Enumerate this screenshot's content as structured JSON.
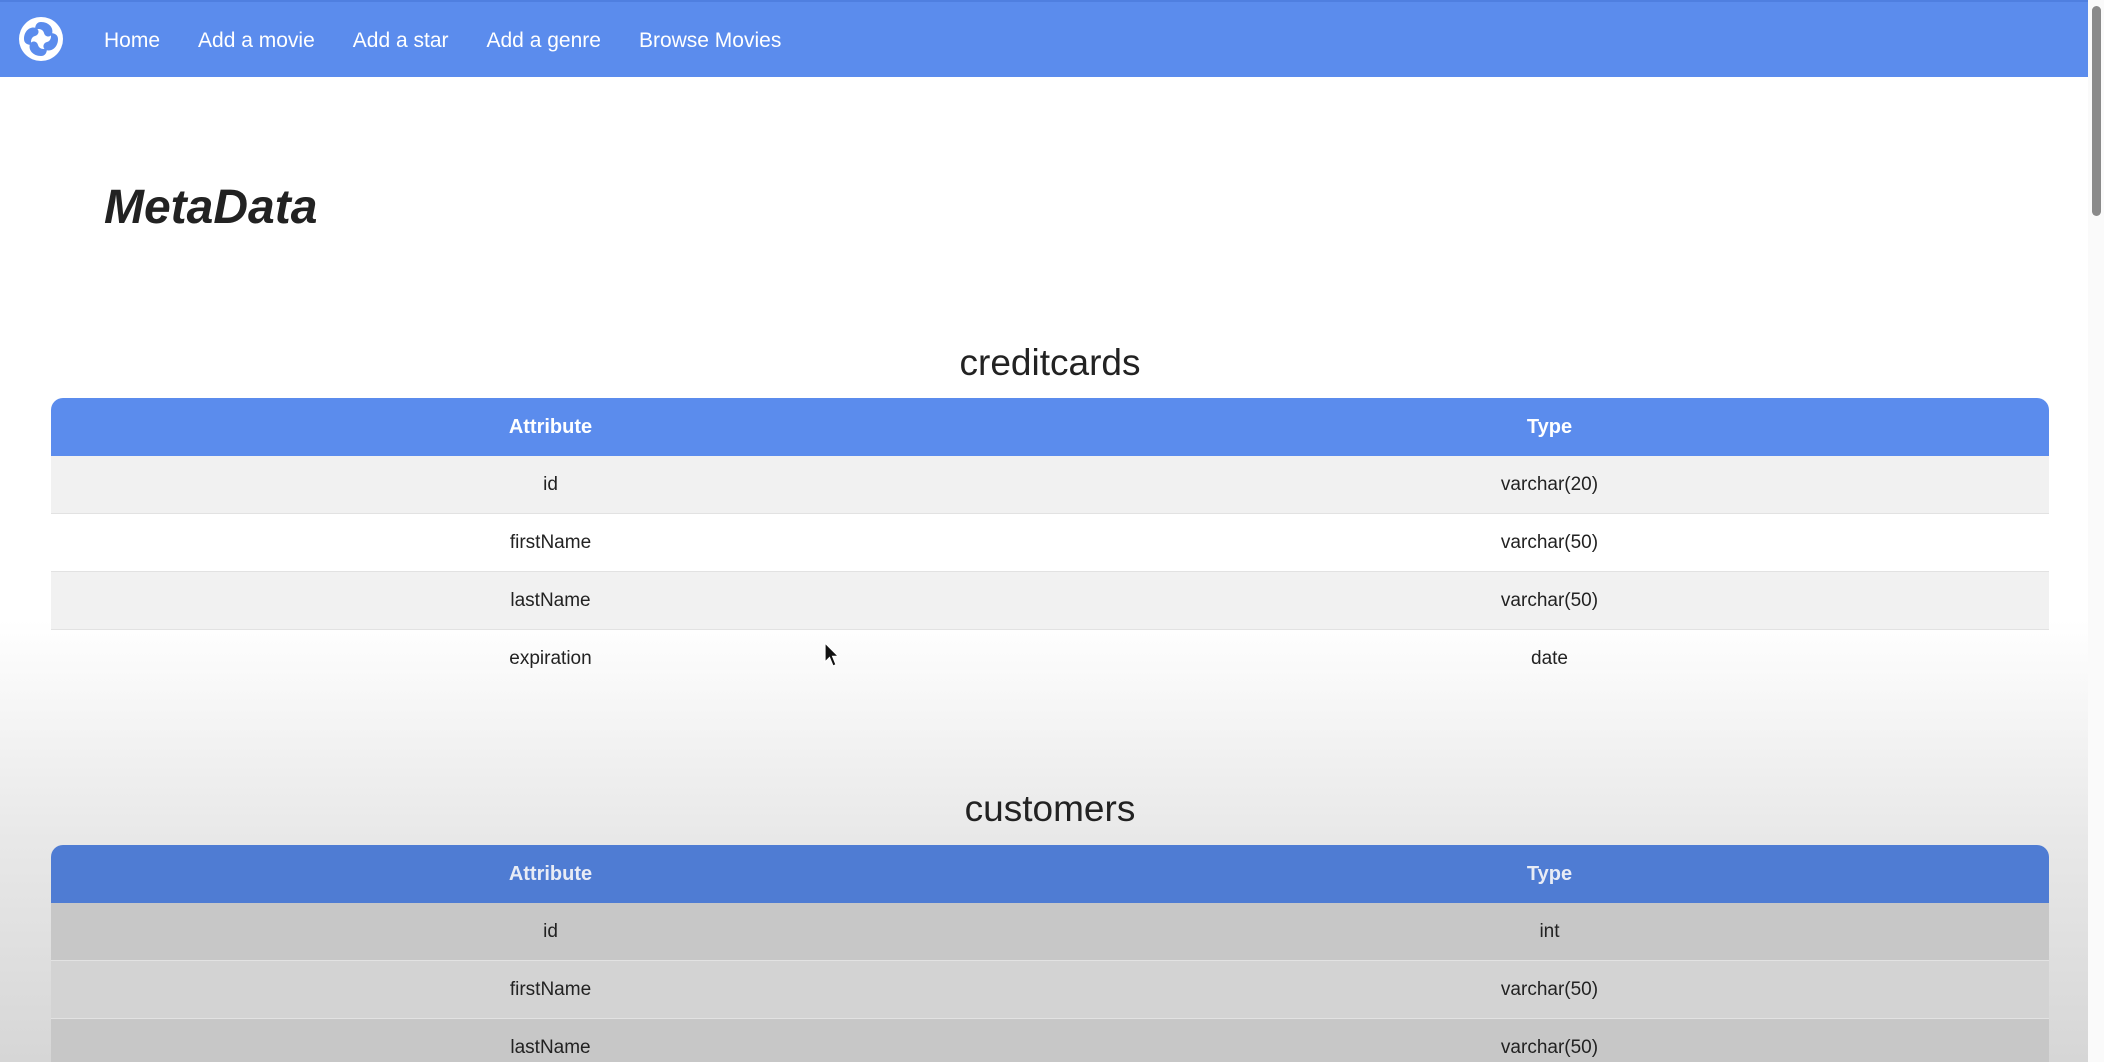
{
  "nav": {
    "logo_icon": "pinwheel-logo-icon",
    "links": [
      "Home",
      "Add a movie",
      "Add a star",
      "Add a genre",
      "Browse Movies"
    ]
  },
  "page": {
    "title": "MetaData"
  },
  "tables": [
    {
      "name": "creditcards",
      "headers": [
        "Attribute",
        "Type"
      ],
      "rows": [
        [
          "id",
          "varchar(20)"
        ],
        [
          "firstName",
          "varchar(50)"
        ],
        [
          "lastName",
          "varchar(50)"
        ],
        [
          "expiration",
          "date"
        ]
      ]
    },
    {
      "name": "customers",
      "headers": [
        "Attribute",
        "Type"
      ],
      "rows": [
        [
          "id",
          "int"
        ],
        [
          "firstName",
          "varchar(50)"
        ],
        [
          "lastName",
          "varchar(50)"
        ]
      ]
    }
  ],
  "colors": {
    "accent": "#5b8ced",
    "row_alt": "#f1f1f1"
  }
}
